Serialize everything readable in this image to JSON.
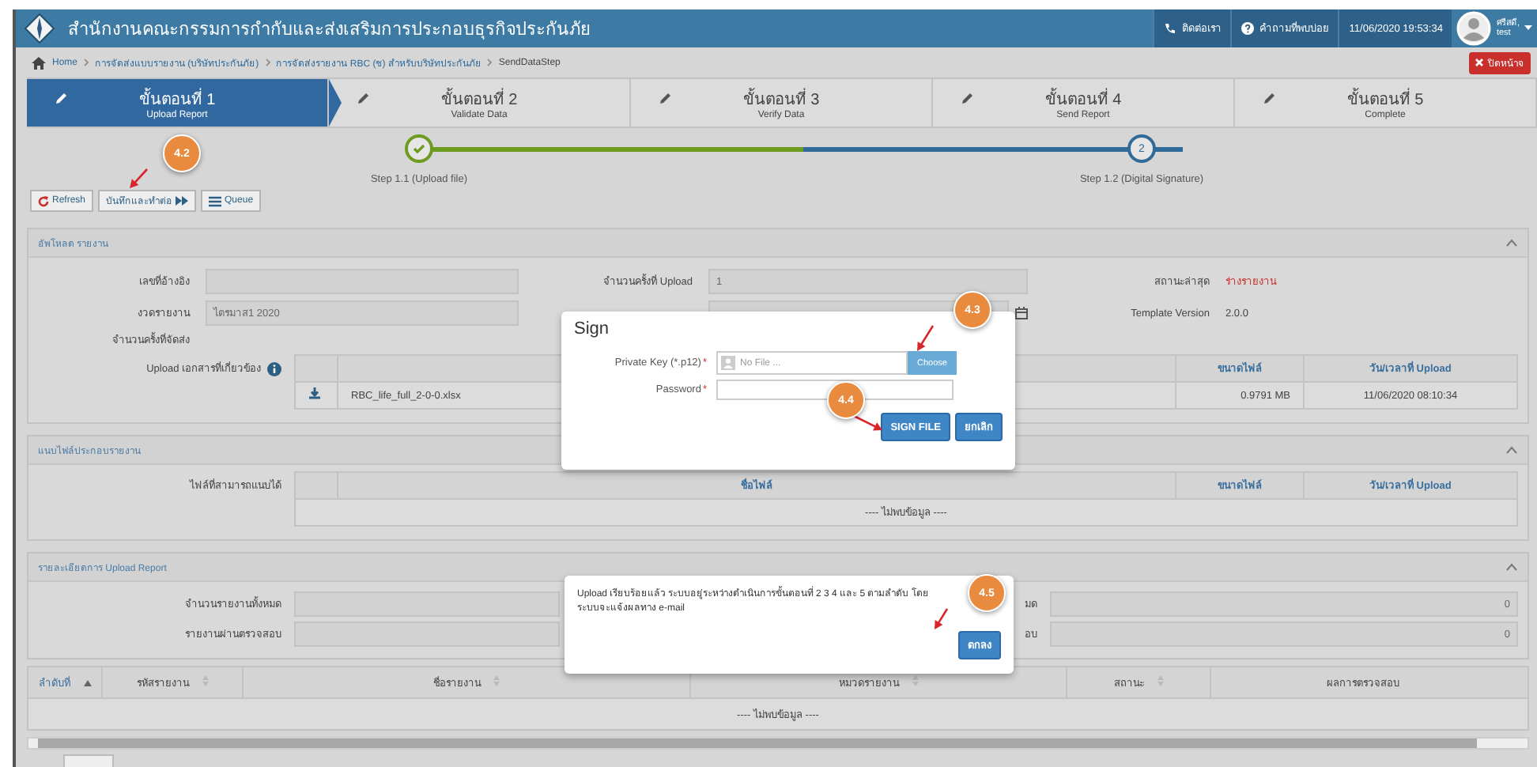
{
  "header": {
    "title": "สำนักงานคณะกรรมการกำกับและส่งเสริมการประกอบธุรกิจประกันภัย",
    "links": [
      {
        "kind": "phone",
        "label": "ติดต่อเรา"
      },
      {
        "kind": "help",
        "label": "คำถามที่พบบ่อย"
      }
    ],
    "datetime": "11/06/2020 19:53:34",
    "user": {
      "name": "ศรีสดี,",
      "sub": "test"
    }
  },
  "breadcrumb": [
    "Home",
    "การจัดส่งแบบรายงาน (บริษัทประกันภัย)",
    "การจัดส่งรายงาน RBC (ช) สำหรับบริษัทประกันภัย",
    "SendDataStep"
  ],
  "close_button": "ปิดหน้าจ",
  "steps": [
    {
      "title": "ขั้นตอนที่ 1",
      "subtitle": "Upload Report",
      "selected": true
    },
    {
      "title": "ขั้นตอนที่ 2",
      "subtitle": "Validate Data",
      "selected": false
    },
    {
      "title": "ขั้นตอนที่ 3",
      "subtitle": "Verify Data",
      "selected": false
    },
    {
      "title": "ขั้นตอนที่ 4",
      "subtitle": "Send Report",
      "selected": false
    },
    {
      "title": "ขั้นตอนที่ 5",
      "subtitle": "Complete",
      "selected": false
    }
  ],
  "progress": [
    {
      "label": "Step 1.1 (Upload file)",
      "done": true
    },
    {
      "label": "Step 1.2 (Digital Signature)",
      "number": "2",
      "done": false
    }
  ],
  "toolbar": [
    {
      "kind": "refresh",
      "label": "Refresh"
    },
    {
      "kind": "next",
      "label": "บันทึกและทำต่อ"
    },
    {
      "kind": "queue",
      "label": "Queue"
    }
  ],
  "upload_panel": {
    "title": "อัพโหลด รายงาน",
    "rows": [
      [
        {
          "kind": "input",
          "label": "เลขที่อ้างอิง"
        },
        {
          "kind": "input",
          "label": "จำนวนครั้งที่ Upload",
          "value": "1"
        },
        {
          "kind": "status",
          "label": "สถานะล่าสุด",
          "value": "ร่างรายงาน"
        }
      ],
      [
        {
          "kind": "input",
          "label": "งวดรายงาน",
          "value": "ไตรมาส1 2020"
        },
        {
          "kind": "date"
        },
        {
          "kind": "text",
          "label": "Template Version",
          "value": "2.0.0"
        }
      ],
      [
        {
          "kind": "label",
          "label": "จำนวนครั้งที่จัดส่ง"
        }
      ]
    ],
    "files_label": "Upload เอกสารที่เกี่ยวข้อง",
    "files_columns": [
      "ขนาดไฟล์",
      "วัน/เวลาที่ Upload"
    ],
    "files": [
      {
        "name": "RBC_life_full_2-0-0.xlsx",
        "size": "0.9791 MB",
        "uploaded": "11/06/2020 08:10:34"
      }
    ]
  },
  "attach_panel": {
    "title": "แนบไฟล์ประกอบรายงาน",
    "label": "ไฟล์ที่สามารถแนบได้",
    "columns": [
      "ชื่อไฟล์",
      "ขนาดไฟล์",
      "วัน/เวลาที่ Upload"
    ],
    "empty": "---- ไม่พบข้อมูล ----"
  },
  "detail_panel": {
    "title": "รายละเอียดการ Upload Report",
    "rows": [
      {
        "label": "จำนวนรายงานทั้งหมด",
        "label_2": "มด",
        "value_2": "0"
      },
      {
        "label": "รายงานผ่านตรวจสอบ",
        "label_2": "อบ",
        "value_2": "0"
      }
    ]
  },
  "table": {
    "columns": [
      {
        "label": "ลำดับที่",
        "sorted": true
      },
      {
        "label": "รหัสรายงาน",
        "sorted": false
      },
      {
        "label": "ชื่อรายงาน",
        "sorted": false
      },
      {
        "label": "หมวดรายงาน",
        "sorted": false
      },
      {
        "label": "สถานะ",
        "sorted": false
      },
      {
        "label": "ผลการตรวจสอบ"
      }
    ],
    "empty": "---- ไม่พบข้อมูล ----"
  },
  "sign_dialog": {
    "title": "Sign",
    "fields": [
      {
        "kind": "file",
        "label": "Private Key (*.p12)",
        "required_mark": "*",
        "placeholder": "No File ...",
        "button": "Choose"
      },
      {
        "kind": "password",
        "label": "Password",
        "required_mark": "*"
      }
    ],
    "buttons": [
      "SIGN FILE",
      "ยกเลิก"
    ]
  },
  "alert_dialog": {
    "message": "Upload เรียบร้อยแล้ว ระบบอยู่ระหว่างดำเนินการขั้นตอนที่ 2 3 4 และ 5 ตามลำดับ โดยระบบจะแจ้งผลทาง e-mail",
    "button": "ตกลง"
  },
  "callouts": [
    {
      "label": "4.2"
    },
    {
      "label": "4.3"
    },
    {
      "label": "4.4"
    },
    {
      "label": "4.5"
    }
  ]
}
